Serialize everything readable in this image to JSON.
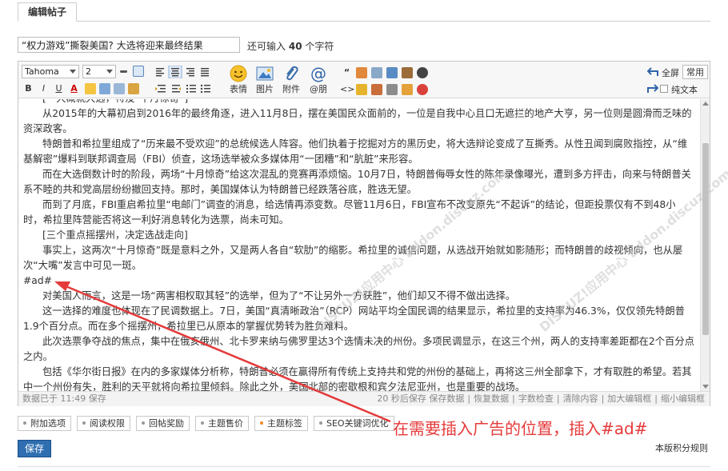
{
  "tab": {
    "label": "编辑帖子"
  },
  "subject": {
    "value": "“权力游戏”撕裂美国? 大选将迎来最终结果",
    "hint_prefix": "还可输入",
    "hint_count": "40",
    "hint_suffix": "个字符"
  },
  "toolbar": {
    "font_family": "Tahoma",
    "font_size": "2",
    "buttons": {
      "bold": "B",
      "italic": "I",
      "underline": "U",
      "forecolor": "A"
    },
    "big_buttons": [
      {
        "label": "表情",
        "icon": "smiley-icon"
      },
      {
        "label": "图片",
        "icon": "image-icon"
      },
      {
        "label": "附件",
        "icon": "paperclip-icon"
      },
      {
        "label": "@朋",
        "icon": "at-icon"
      }
    ],
    "fullscreen": "全屏",
    "common": "常用",
    "plaintext": "纯文本"
  },
  "content": {
    "paragraphs": [
      "[一大概就大选，特没“十月惊奇”]",
      "从2015年的大幕初启到2016年的最终角逐，进入11月8日，摆在美国民众面前的，一位是自我中心且口无遮拦的地产大亨，另一位则是圆滑而乏味的资深政客。",
      "特朗普和希拉里组成了“历来最不受欢迎”的总统候选人阵容。他们执着于挖掘对方的黑历史，将大选辩论变成了互撕秀。从性丑闻到腐败指控，从“维基解密”爆料到联邦调查局（FBI）侦查，这场选举被众多媒体用“一团糟”和“肮脏”来形容。",
      "而在大选倒数计时的阶段，两场“十月惊奇”给这次混乱的竞赛再添烦恼。10月7日，特朗普侮辱女性的陈年录像曝光，遭到多方抨击，向来与特朗普关系不睦的共和党高层纷纷撤回支持。那时，美国媒体认为特朗普已经跌落谷底，胜选无望。",
      "而到了月底，FBI重启希拉里“电邮门”调查的消息，给选情再添变数。尽管11月6日，FBI宣布不改变原先“不起诉”的结论，但距投票仅有不到48小时，希拉里阵营能否将这一利好消息转化为选票，尚未可知。",
      "[三个重点摇摆州，决定选战走向]",
      "事实上，这两次“十月惊奇”既是意料之外，又是两人各自“软肋”的缩影。希拉里的诚信问题，从选战开始就如影随形；而特朗普的歧视倾向，也从屡次“大嘴”发言中可见一斑。",
      "#ad#",
      "对美国人而言，这是一场“两害相权取其轻”的选举，但为了“不让另外一方获胜”，他们却又不得不做出选择。",
      "这一选择的难度也体现在了民调数据上。7日，美国“真清晰政治”（RCP）网站平均全国民调的结果显示，希拉里的支持率为46.3%，仅仅领先特朗普1.9个百分点。而在多个摇摆州，希拉里已从原本的掌握优势转为胜负难料。",
      "此次选票争夺战的焦点，集中在俄亥俄州、北卡罗来纳与佛罗里达3个选情未决的州份。多项民调显示，在这三个州，两人的支持率差距都在2个百分点之内。",
      "包括《华尔街日报》在内的多家媒体分析称，特朗普必须在赢得所有传统上支持共和党的州份的基础上，再将这三州全部拿下，才有取胜的希望。若其中一个州份有失，胜利的天平就将向希拉里倾斜。除此之外，美国北部的密歇根和宾夕法尼亚州，也是重要的战场。"
    ]
  },
  "statusbar": {
    "left": "数据已于 11:49 保存",
    "right": [
      "20 秒后保存 保存数据",
      "|",
      "恢复数据",
      "|",
      "字数检查",
      "|",
      "清除内容",
      "|",
      "加大编辑框",
      "|",
      "缩小编辑框"
    ]
  },
  "options": [
    {
      "label": "附加选项"
    },
    {
      "label": "阅读权限"
    },
    {
      "label": "回帖奖励"
    },
    {
      "label": "主题售价"
    },
    {
      "label": "主题标签"
    },
    {
      "label": "SEO关键词优化"
    }
  ],
  "submit_label": "保存",
  "rules_link": "本版积分规则",
  "annotation": "在需要插入广告的位置，插入#ad#",
  "watermark_text": "DISCUZ!应用中心 addon.discuz.com",
  "colors": {
    "annotation": "#e53a3a",
    "submit": "#2f6fb1",
    "option_active": "#f08a24"
  }
}
